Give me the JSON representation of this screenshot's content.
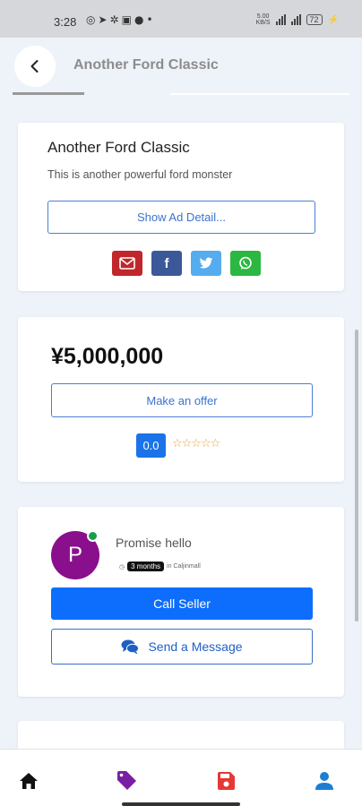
{
  "status_bar": {
    "time": "3:28",
    "net_speed_top": "5.00",
    "net_speed_bottom": "KB/S",
    "battery": "72"
  },
  "header": {
    "title": "Another Ford Classic"
  },
  "ad": {
    "title": "Another Ford Classic",
    "description": "This is another powerful ford monster",
    "detail_button": "Show Ad Detail..."
  },
  "share": {
    "colors": {
      "email": "#c0262b",
      "facebook": "#3b5998",
      "twitter": "#55acee",
      "whatsapp": "#2bb741"
    }
  },
  "pricing": {
    "price": "¥5,000,000",
    "offer_button": "Make an offer",
    "rating": "0.0",
    "stars": "☆☆☆☆☆"
  },
  "seller": {
    "initial": "P",
    "name": "Promise hello",
    "member_duration": "3 months",
    "member_suffix": "in Caljinmall",
    "call_button": "Call Seller",
    "message_button": "Send a Message"
  },
  "bottom_nav": {
    "colors": {
      "home": "#111111",
      "tags": "#7a1fa2",
      "saved": "#e53935",
      "profile": "#1a7fd4"
    }
  }
}
